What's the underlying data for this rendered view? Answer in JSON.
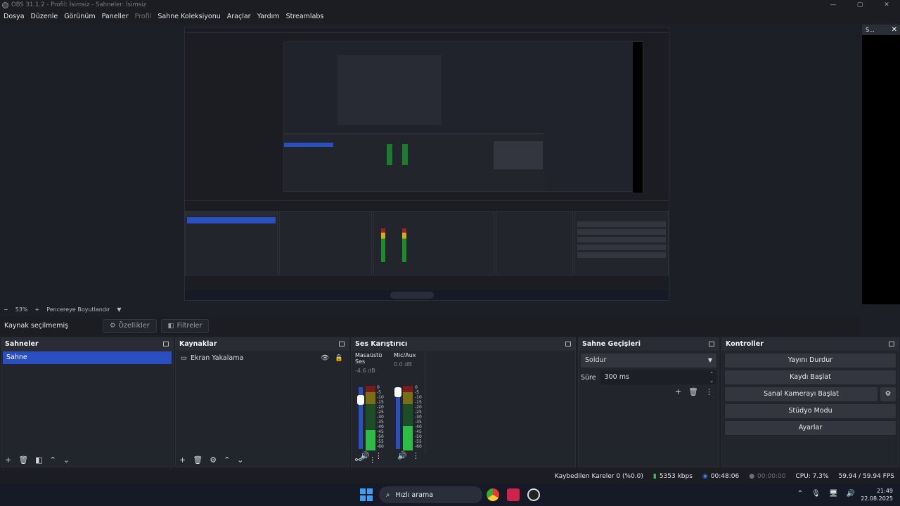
{
  "window": {
    "title": "OBS 31.1.2 - Profil: İsimsiz - Sahneler: İsimsiz",
    "min": "—",
    "max": "▢",
    "close": "✕"
  },
  "menu": [
    "Dosya",
    "Düzenle",
    "Görünüm",
    "Paneller",
    "Profil",
    "Sahne Koleksiyonu",
    "Araçlar",
    "Yardım",
    "Streamlabs"
  ],
  "dock_right": {
    "label": "S...",
    "close": "✕"
  },
  "zoom": {
    "minus": "−",
    "value": "53%",
    "plus": "+",
    "fit": "Pencereye Boyutlandır"
  },
  "source_bar": {
    "label": "Kaynak seçilmemiş",
    "properties": "Özellikler",
    "filters": "Filtreler"
  },
  "scenes": {
    "title": "Sahneler",
    "items": [
      "Sahne"
    ]
  },
  "sources": {
    "title": "Kaynaklar",
    "items": [
      "Ekran Yakalama"
    ]
  },
  "mixer": {
    "title": "Ses Karıştırıcı",
    "channels": [
      {
        "name": "Masaüstü Ses",
        "db": "-4.6 dB",
        "level": 0.32
      },
      {
        "name": "Mic/Aux",
        "db": "0.0 dB",
        "level": 0.38
      }
    ],
    "ticks": [
      "0",
      "-5",
      "-10",
      "-15",
      "-20",
      "-25",
      "-30",
      "-35",
      "-40",
      "-45",
      "-50",
      "-55",
      "-60"
    ]
  },
  "transitions": {
    "title": "Sahne Geçişleri",
    "selected": "Soldur",
    "duration_label": "Süre",
    "duration": "300 ms"
  },
  "controls": {
    "title": "Kontroller",
    "buttons": [
      "Yayını Durdur",
      "Kaydı Başlat",
      "Sanal Kamerayı Başlat",
      "Stüdyo Modu",
      "Ayarlar"
    ]
  },
  "status": {
    "dropped": "Kaybedilen Kareler 0 (%0.0)",
    "bitrate": "5353 kbps",
    "stream_time": "00:48:06",
    "rec_time": "00:00:00",
    "cpu": "CPU: 7.3%",
    "fps": "59.94 / 59.94 FPS"
  },
  "taskbar": {
    "search": "Hızlı arama",
    "time": "21:49",
    "date": "22.08.2025"
  },
  "colors": {
    "accent": "#2a4fc0",
    "bg": "#1d1f26",
    "panel": "#23252c",
    "button": "#33363f"
  }
}
